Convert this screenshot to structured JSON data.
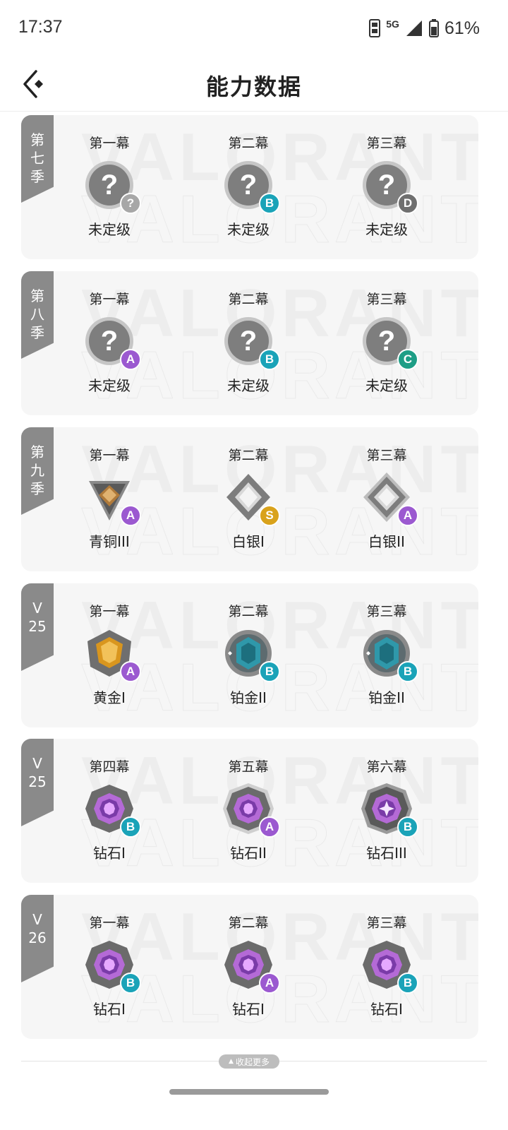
{
  "status_bar": {
    "time": "17:37",
    "network": "5G",
    "battery": "61%"
  },
  "header": {
    "title": "能力数据",
    "back_icon": "back-chevron-icon"
  },
  "watermark_text": "VALORANT",
  "seasons": [
    {
      "tag": [
        "第",
        "七",
        "季"
      ],
      "acts": [
        {
          "label": "第一幕",
          "rank": "未定级",
          "icon": "unranked",
          "grade": "?"
        },
        {
          "label": "第二幕",
          "rank": "未定级",
          "icon": "unranked",
          "grade": "B"
        },
        {
          "label": "第三幕",
          "rank": "未定级",
          "icon": "unranked",
          "grade": "D"
        }
      ]
    },
    {
      "tag": [
        "第",
        "八",
        "季"
      ],
      "acts": [
        {
          "label": "第一幕",
          "rank": "未定级",
          "icon": "unranked",
          "grade": "A"
        },
        {
          "label": "第二幕",
          "rank": "未定级",
          "icon": "unranked",
          "grade": "B"
        },
        {
          "label": "第三幕",
          "rank": "未定级",
          "icon": "unranked",
          "grade": "C"
        }
      ]
    },
    {
      "tag": [
        "第",
        "九",
        "季"
      ],
      "acts": [
        {
          "label": "第一幕",
          "rank": "青铜III",
          "icon": "bronze",
          "grade": "A"
        },
        {
          "label": "第二幕",
          "rank": "白银I",
          "icon": "silver",
          "grade": "S"
        },
        {
          "label": "第三幕",
          "rank": "白银II",
          "icon": "silver2",
          "grade": "A"
        }
      ]
    },
    {
      "tag": [
        "V",
        "25"
      ],
      "acts": [
        {
          "label": "第一幕",
          "rank": "黄金I",
          "icon": "gold",
          "grade": "A"
        },
        {
          "label": "第二幕",
          "rank": "铂金II",
          "icon": "platinum",
          "grade": "B"
        },
        {
          "label": "第三幕",
          "rank": "铂金II",
          "icon": "platinum",
          "grade": "B"
        }
      ]
    },
    {
      "tag": [
        "V",
        "25"
      ],
      "acts": [
        {
          "label": "第四幕",
          "rank": "钻石I",
          "icon": "diamond",
          "grade": "B"
        },
        {
          "label": "第五幕",
          "rank": "钻石II",
          "icon": "diamond2",
          "grade": "A"
        },
        {
          "label": "第六幕",
          "rank": "钻石III",
          "icon": "diamond3",
          "grade": "B"
        }
      ]
    },
    {
      "tag": [
        "V",
        "26"
      ],
      "acts": [
        {
          "label": "第一幕",
          "rank": "钻石I",
          "icon": "diamond",
          "grade": "B"
        },
        {
          "label": "第二幕",
          "rank": "钻石I",
          "icon": "diamond",
          "grade": "A"
        },
        {
          "label": "第三幕",
          "rank": "钻石I",
          "icon": "diamond",
          "grade": "B"
        }
      ]
    }
  ],
  "grade_colors": {
    "?": "#a7a7a7",
    "A": "#9b59d0",
    "B": "#1aa3b8",
    "C": "#1e9e86",
    "D": "#6f6f6f",
    "S": "#d9a21b"
  },
  "collapse_label": "收起更多"
}
